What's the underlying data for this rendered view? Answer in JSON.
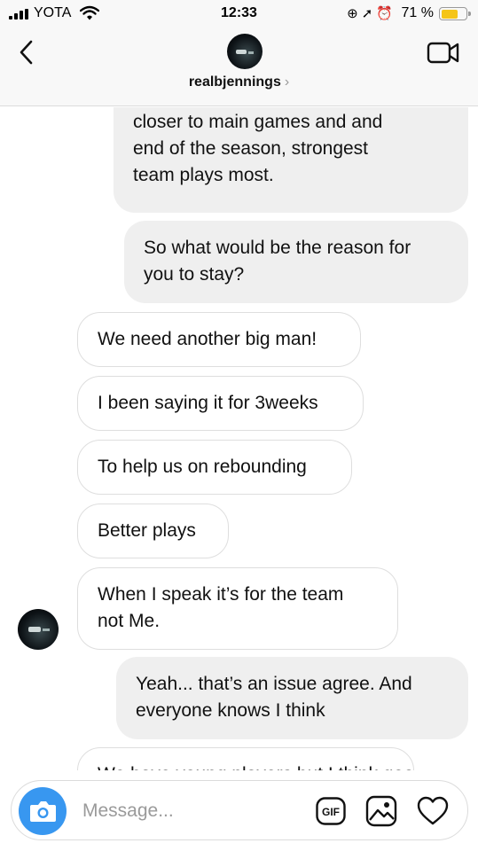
{
  "status_bar": {
    "carrier": "YOTA",
    "time": "12:33",
    "battery_percent": "71 %",
    "battery_level": 0.71,
    "battery_color": "#f5c518",
    "icons": [
      "signal-icon",
      "wifi-icon",
      "rotation-lock-icon",
      "location-icon",
      "alarm-icon",
      "battery-icon"
    ]
  },
  "header": {
    "username": "realbjennings",
    "chevron": "›",
    "icons": [
      "back-arrow-icon",
      "avatar",
      "video-call-icon"
    ]
  },
  "messages": [
    {
      "side": "out",
      "text": "I remember in previous seasons\ncloser to main games and and\nend of the season, strongest\nteam plays most."
    },
    {
      "side": "out",
      "text": "So what would be the reason for\nyou to stay?"
    },
    {
      "side": "in",
      "text": "We need another big man!"
    },
    {
      "side": "in",
      "text": "I been saying it for 3weeks"
    },
    {
      "side": "in",
      "text": "To help us on rebounding"
    },
    {
      "side": "in",
      "text": "Better plays"
    },
    {
      "side": "in",
      "text": "When I speak it’s for the team\nnot Me."
    },
    {
      "side": "out",
      "text": "Yeah... that’s an issue agree. And\neveryone knows I think"
    },
    {
      "side": "in",
      "text": "We have young players but I think good for"
    }
  ],
  "composer": {
    "placeholder": "Message...",
    "gif_label": "GIF",
    "accent_color": "#3897f0",
    "icons": [
      "camera-icon",
      "gif-icon",
      "gallery-icon",
      "heart-icon"
    ]
  }
}
